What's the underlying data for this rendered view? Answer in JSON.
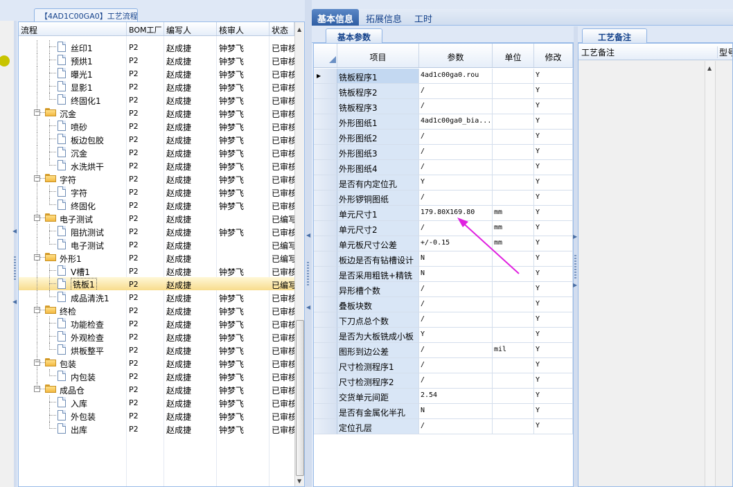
{
  "process_tab": {
    "label": "【4AD1C00GA0】工艺流程"
  },
  "tree": {
    "columns": [
      "流程",
      "BOM工厂",
      "编写人",
      "核审人",
      "状态"
    ],
    "rows": [
      {
        "name": "丝印1",
        "type": "leaf",
        "bom": "P2",
        "writer": "赵成捷",
        "auditor": "钟梦飞",
        "status": "已审核"
      },
      {
        "name": "预烘1",
        "type": "leaf",
        "bom": "P2",
        "writer": "赵成捷",
        "auditor": "钟梦飞",
        "status": "已审核"
      },
      {
        "name": "曝光1",
        "type": "leaf",
        "bom": "P2",
        "writer": "赵成捷",
        "auditor": "钟梦飞",
        "status": "已审核"
      },
      {
        "name": "显影1",
        "type": "leaf",
        "bom": "P2",
        "writer": "赵成捷",
        "auditor": "钟梦飞",
        "status": "已审核"
      },
      {
        "name": "终固化1",
        "type": "leaf",
        "bom": "P2",
        "writer": "赵成捷",
        "auditor": "钟梦飞",
        "status": "已审核"
      },
      {
        "name": "沉金",
        "type": "folder",
        "bom": "P2",
        "writer": "赵成捷",
        "auditor": "钟梦飞",
        "status": "已审核"
      },
      {
        "name": "喷砂",
        "type": "leaf",
        "bom": "P2",
        "writer": "赵成捷",
        "auditor": "钟梦飞",
        "status": "已审核"
      },
      {
        "name": "板边包胶",
        "type": "leaf",
        "bom": "P2",
        "writer": "赵成捷",
        "auditor": "钟梦飞",
        "status": "已审核"
      },
      {
        "name": "沉金",
        "type": "leaf",
        "bom": "P2",
        "writer": "赵成捷",
        "auditor": "钟梦飞",
        "status": "已审核"
      },
      {
        "name": "水洗烘干",
        "type": "leaf",
        "bom": "P2",
        "writer": "赵成捷",
        "auditor": "钟梦飞",
        "status": "已审核"
      },
      {
        "name": "字符",
        "type": "folder",
        "bom": "P2",
        "writer": "赵成捷",
        "auditor": "钟梦飞",
        "status": "已审核"
      },
      {
        "name": "字符",
        "type": "leaf",
        "bom": "P2",
        "writer": "赵成捷",
        "auditor": "钟梦飞",
        "status": "已审核"
      },
      {
        "name": "终固化",
        "type": "leaf",
        "bom": "P2",
        "writer": "赵成捷",
        "auditor": "钟梦飞",
        "status": "已审核"
      },
      {
        "name": "电子测试",
        "type": "folder",
        "bom": "P2",
        "writer": "赵成捷",
        "auditor": "",
        "status": "已编写"
      },
      {
        "name": "阻抗测试",
        "type": "leaf",
        "bom": "P2",
        "writer": "赵成捷",
        "auditor": "钟梦飞",
        "status": "已审核"
      },
      {
        "name": "电子测试",
        "type": "leaf",
        "bom": "P2",
        "writer": "赵成捷",
        "auditor": "",
        "status": "已编写"
      },
      {
        "name": "外形1",
        "type": "folder",
        "bom": "P2",
        "writer": "赵成捷",
        "auditor": "",
        "status": "已编写"
      },
      {
        "name": "V槽1",
        "type": "leaf",
        "bom": "P2",
        "writer": "赵成捷",
        "auditor": "钟梦飞",
        "status": "已审核"
      },
      {
        "name": "铣板1",
        "type": "leaf",
        "bom": "P2",
        "writer": "赵成捷",
        "auditor": "",
        "status": "已编写",
        "selected": true
      },
      {
        "name": "成品清洗1",
        "type": "leaf",
        "bom": "P2",
        "writer": "赵成捷",
        "auditor": "钟梦飞",
        "status": "已审核"
      },
      {
        "name": "终检",
        "type": "folder",
        "bom": "P2",
        "writer": "赵成捷",
        "auditor": "钟梦飞",
        "status": "已审核"
      },
      {
        "name": "功能检查",
        "type": "leaf",
        "bom": "P2",
        "writer": "赵成捷",
        "auditor": "钟梦飞",
        "status": "已审核"
      },
      {
        "name": "外观检查",
        "type": "leaf",
        "bom": "P2",
        "writer": "赵成捷",
        "auditor": "钟梦飞",
        "status": "已审核"
      },
      {
        "name": "烘板整平",
        "type": "leaf",
        "bom": "P2",
        "writer": "赵成捷",
        "auditor": "钟梦飞",
        "status": "已审核"
      },
      {
        "name": "包装",
        "type": "folder",
        "bom": "P2",
        "writer": "赵成捷",
        "auditor": "钟梦飞",
        "status": "已审核"
      },
      {
        "name": "内包装",
        "type": "leaf",
        "bom": "P2",
        "writer": "赵成捷",
        "auditor": "钟梦飞",
        "status": "已审核"
      },
      {
        "name": "成品仓",
        "type": "folder",
        "bom": "P2",
        "writer": "赵成捷",
        "auditor": "钟梦飞",
        "status": "已审核"
      },
      {
        "name": "入库",
        "type": "leaf",
        "bom": "P2",
        "writer": "赵成捷",
        "auditor": "钟梦飞",
        "status": "已审核"
      },
      {
        "name": "外包装",
        "type": "leaf",
        "bom": "P2",
        "writer": "赵成捷",
        "auditor": "钟梦飞",
        "status": "已审核"
      },
      {
        "name": "出库",
        "type": "leaf",
        "bom": "P2",
        "writer": "赵成捷",
        "auditor": "钟梦飞",
        "status": "已审核"
      }
    ]
  },
  "main_tabs": [
    "基本信息",
    "拓展信息",
    "工时"
  ],
  "params": {
    "tab_label": "基本参数",
    "columns": [
      "项目",
      "参数",
      "单位",
      "修改"
    ],
    "rows": [
      {
        "item": "铣板程序1",
        "value": "4ad1c00ga0.rou",
        "unit": "",
        "mod": "Y",
        "current": true
      },
      {
        "item": "铣板程序2",
        "value": "/",
        "unit": "",
        "mod": "Y"
      },
      {
        "item": "铣板程序3",
        "value": "/",
        "unit": "",
        "mod": "Y"
      },
      {
        "item": "外形图纸1",
        "value": "4ad1c00ga0_bia...",
        "unit": "",
        "mod": "Y"
      },
      {
        "item": "外形图纸2",
        "value": "/",
        "unit": "",
        "mod": "Y"
      },
      {
        "item": "外形图纸3",
        "value": "/",
        "unit": "",
        "mod": "Y"
      },
      {
        "item": "外形图纸4",
        "value": "/",
        "unit": "",
        "mod": "Y"
      },
      {
        "item": "是否有内定位孔",
        "value": "Y",
        "unit": "",
        "mod": "Y"
      },
      {
        "item": "外形锣铜图纸",
        "value": "/",
        "unit": "",
        "mod": "Y"
      },
      {
        "item": "单元尺寸1",
        "value": "179.80X169.80",
        "unit": "mm",
        "mod": "Y"
      },
      {
        "item": "单元尺寸2",
        "value": "/",
        "unit": "mm",
        "mod": "Y"
      },
      {
        "item": "单元板尺寸公差",
        "value": "+/-0.15",
        "unit": "mm",
        "mod": "Y"
      },
      {
        "item": "板边是否有钻槽设计",
        "value": "N",
        "unit": "",
        "mod": "Y"
      },
      {
        "item": "是否采用粗铣+精铣",
        "value": "N",
        "unit": "",
        "mod": "Y"
      },
      {
        "item": "异形槽个数",
        "value": "/",
        "unit": "",
        "mod": "Y"
      },
      {
        "item": "叠板块数",
        "value": "/",
        "unit": "",
        "mod": "Y"
      },
      {
        "item": "下刀点总个数",
        "value": "/",
        "unit": "",
        "mod": "Y"
      },
      {
        "item": "是否为大板铣成小板",
        "value": "Y",
        "unit": "",
        "mod": "Y"
      },
      {
        "item": "图形到边公差",
        "value": "/",
        "unit": "mil",
        "mod": "Y"
      },
      {
        "item": "尺寸检测程序1",
        "value": "/",
        "unit": "",
        "mod": "Y"
      },
      {
        "item": "尺寸检测程序2",
        "value": "/",
        "unit": "",
        "mod": "Y"
      },
      {
        "item": "交货单元间距",
        "value": "2.54",
        "unit": "",
        "mod": "Y"
      },
      {
        "item": "是否有金属化半孔",
        "value": "N",
        "unit": "",
        "mod": "Y"
      },
      {
        "item": "定位孔层",
        "value": "/",
        "unit": "",
        "mod": "Y"
      }
    ]
  },
  "notes": {
    "tab_label": "工艺备注",
    "col1": "工艺备注",
    "col2": "型号"
  },
  "annotation": {
    "color": "#e020e0",
    "icon": "arrow-annotation"
  }
}
